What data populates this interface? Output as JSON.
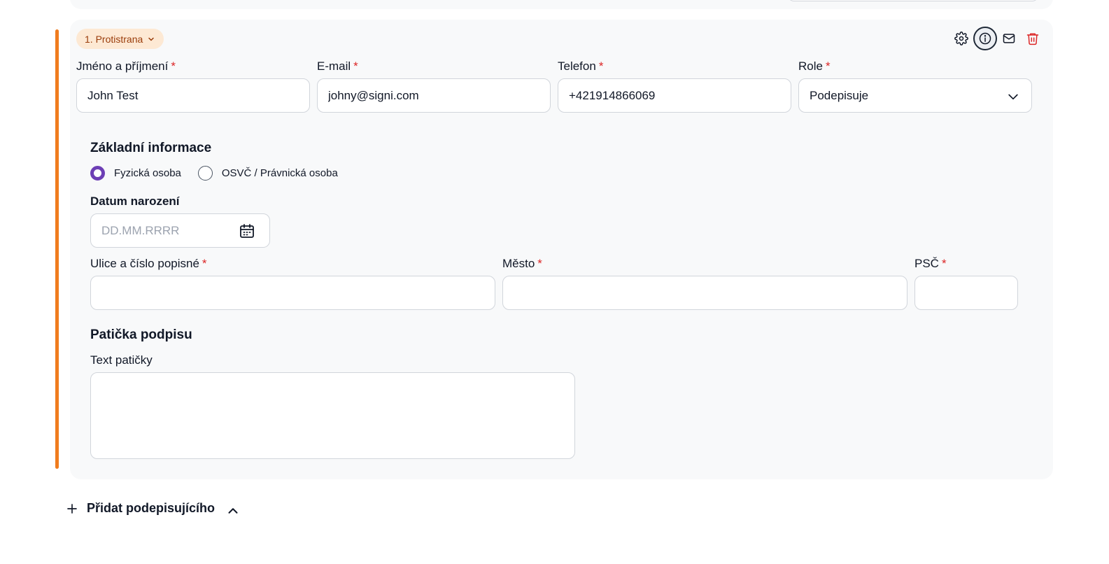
{
  "signer": {
    "badge_label": "1. Protistrana",
    "actions": {
      "settings_icon": "gear-icon",
      "info_icon": "info-icon",
      "mail_icon": "mail-icon",
      "delete_icon": "trash-icon"
    },
    "fields": {
      "name": {
        "label": "Jméno a příjmení",
        "required": "*",
        "value": "John Test"
      },
      "email": {
        "label": "E-mail",
        "required": "*",
        "value": "johny@signi.com"
      },
      "phone": {
        "label": "Telefon",
        "required": "*",
        "value": "+421914866069"
      },
      "role": {
        "label": "Role",
        "required": "*",
        "value": "Podepisuje"
      }
    }
  },
  "basic_info": {
    "title": "Základní informace",
    "radio_natural": "Fyzická osoba",
    "radio_legal": "OSVČ / Právnická osoba",
    "birth_date_label": "Datum narození",
    "birth_date_placeholder": "DD.MM.RRRR",
    "street": {
      "label": "Ulice a číslo popisné",
      "required": "*",
      "value": ""
    },
    "city": {
      "label": "Město",
      "required": "*",
      "value": ""
    },
    "zip": {
      "label": "PSČ",
      "required": "*",
      "value": ""
    }
  },
  "footer": {
    "title": "Patička podpisu",
    "text_label": "Text patičky",
    "text_value": ""
  },
  "add_signer_label": "Přidat podepisujícího",
  "colors": {
    "accent_bar": "#f07c1e",
    "badge_bg": "#fde9d4",
    "radio_checked": "#6d3fb5",
    "delete": "#dc2626",
    "required": "#dc2626"
  }
}
